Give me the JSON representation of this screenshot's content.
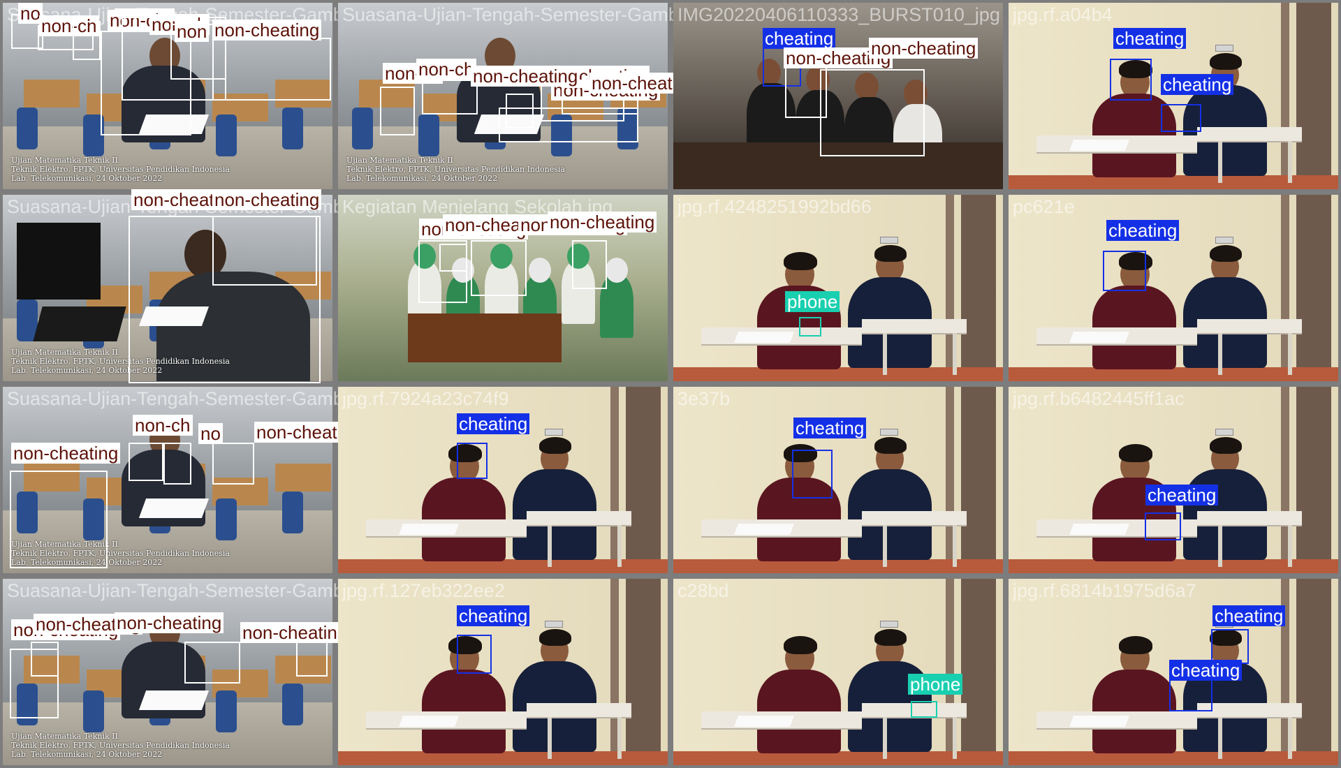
{
  "mosaic": {
    "tiles": [
      {
        "scene": "classroom",
        "filename": "Suasana-Ujian-Tengah-Semester-Gambar",
        "caption": [
          "Ujian Matematika Teknik II",
          "Teknik Elektro, FPTK, Universitas Pendidikan Indonesia",
          "Lab. Telekomunikasi, 24 Oktober 2022"
        ],
        "detections": [
          {
            "label": "no"
          },
          {
            "label": "non-ch"
          },
          {
            "label": "non-ch"
          },
          {
            "label": "non-ch"
          },
          {
            "label": "non-ch"
          },
          {
            "label": "non"
          },
          {
            "label": "non-cheating"
          }
        ]
      },
      {
        "scene": "classroom",
        "filename": "Suasana-Ujian-Tengah-Semester-Gambar",
        "caption": [
          "Ujian Matematika Teknik II",
          "Teknik Elektro, FPTK, Universitas Pendidikan Indonesia",
          "Lab. Telekomunikasi, 24 Oktober 2022"
        ],
        "detections": [
          {
            "label": "non-ch"
          },
          {
            "label": "non-ch"
          },
          {
            "label": "non-cheating"
          },
          {
            "label": "non-cheating"
          },
          {
            "label": "non-cheating"
          },
          {
            "label": "non-cheating"
          }
        ]
      },
      {
        "scene": "lab",
        "filename": "IMG20220406110333_BURST010_jpg",
        "detections": [
          {
            "label": "cheating"
          },
          {
            "label": "non-cheating"
          },
          {
            "label": "non-cheating"
          }
        ]
      },
      {
        "scene": "studio",
        "filename": "jpg.rf.a04b4",
        "detections": [
          {
            "label": "cheating"
          },
          {
            "label": "cheating"
          }
        ]
      },
      {
        "scene": "classroom-close",
        "filename": "Suasana-Ujian-Tengah-Semester-Gambar",
        "caption": [
          "Ujian Matematika Teknik II",
          "Teknik Elektro, FPTK, Universitas Pendidikan Indonesia",
          "Lab. Telekomunikasi, 24 Oktober 2022"
        ],
        "detections": [
          {
            "label": "non-cheating"
          },
          {
            "label": "non-cheating"
          }
        ]
      },
      {
        "scene": "green-class",
        "filename": "Kegiatan Menjelang Sekolah jpg",
        "detections": [
          {
            "label": "non-cheating"
          },
          {
            "label": "non-cheating"
          },
          {
            "label": "non-cheating"
          },
          {
            "label": "non-cheating"
          }
        ]
      },
      {
        "scene": "studio",
        "filename": "jpg.rf.4248251992bd66",
        "detections": [
          {
            "label": "phone"
          }
        ]
      },
      {
        "scene": "studio",
        "filename": "pc621e",
        "detections": [
          {
            "label": "cheating"
          }
        ]
      },
      {
        "scene": "classroom",
        "filename": "Suasana-Ujian-Tengah-Semester-Gambar",
        "caption": [
          "Ujian Matematika Teknik II",
          "Teknik Elektro, FPTK, Universitas Pendidikan Indonesia",
          "Lab. Telekomunikasi, 24 Oktober 2022"
        ],
        "detections": [
          {
            "label": "non-cheating"
          },
          {
            "label": "non-ch"
          },
          {
            "label": "no"
          },
          {
            "label": "non-cheating"
          }
        ]
      },
      {
        "scene": "studio",
        "filename": "jpg.rf.7924a23c74f9",
        "detections": [
          {
            "label": "cheating"
          }
        ]
      },
      {
        "scene": "studio",
        "filename": "3e37b",
        "detections": [
          {
            "label": "cheating"
          }
        ]
      },
      {
        "scene": "studio",
        "filename": "jpg.rf.b6482445ff1ac",
        "detections": [
          {
            "label": "cheating"
          }
        ]
      },
      {
        "scene": "classroom",
        "filename": "Suasana-Ujian-Tengah-Semester-Gambar",
        "caption": [
          "Ujian Matematika Teknik II",
          "Teknik Elektro, FPTK, Universitas Pendidikan Indonesia",
          "Lab. Telekomunikasi, 24 Oktober 2022"
        ],
        "detections": [
          {
            "label": "non-cheating"
          },
          {
            "label": "non-cheating"
          },
          {
            "label": "non-cheating"
          },
          {
            "label": "non-cheating"
          }
        ]
      },
      {
        "scene": "studio",
        "filename": "jpg.rf.127eb322ee2",
        "detections": [
          {
            "label": "cheating"
          }
        ]
      },
      {
        "scene": "studio",
        "filename": "c28bd",
        "detections": [
          {
            "label": "phone"
          }
        ]
      },
      {
        "scene": "studio",
        "filename": "jpg.rf.6814b1975d6a7",
        "detections": [
          {
            "label": "cheating"
          },
          {
            "label": "cheating"
          }
        ]
      }
    ]
  }
}
